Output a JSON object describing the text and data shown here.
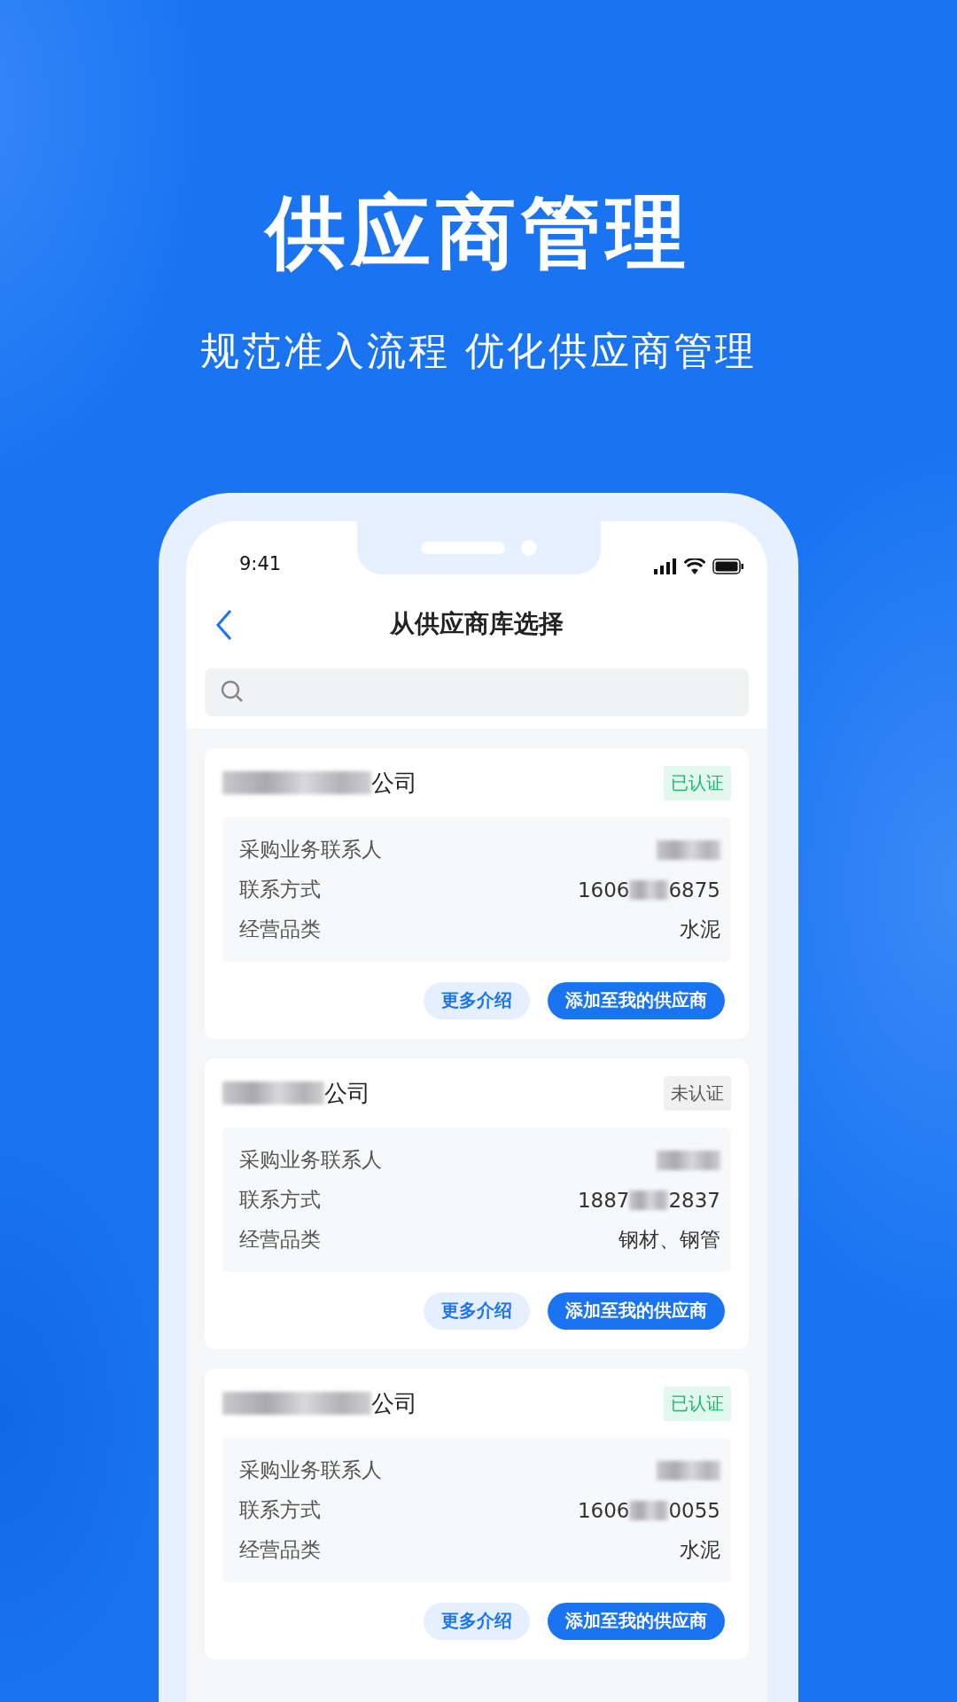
{
  "headline": "供应商管理",
  "subheadline": "规范准入流程 优化供应商管理",
  "status_bar": {
    "time": "9:41"
  },
  "nav": {
    "title": "从供应商库选择"
  },
  "suppliers": [
    {
      "name": [
        {
          "kind": "redacted"
        },
        {
          "kind": "text",
          "text": "公司"
        }
      ],
      "certified": true,
      "badge": "已认证",
      "fields": [
        {
          "label": "采购业务联系人",
          "value": [
            {
              "kind": "redacted"
            }
          ]
        },
        {
          "label": "联系方式",
          "value": [
            {
              "kind": "text",
              "text": "1606"
            },
            {
              "kind": "redacted"
            },
            {
              "kind": "text",
              "text": "6875"
            }
          ]
        },
        {
          "label": "经营品类",
          "value": [
            {
              "kind": "text",
              "text": "水泥"
            }
          ]
        }
      ],
      "buttons": [
        "更多介绍",
        "添加至我的供应商"
      ]
    },
    {
      "name": [
        {
          "kind": "redacted"
        },
        {
          "kind": "text",
          "text": "公司"
        }
      ],
      "certified": false,
      "badge": "未认证",
      "fields": [
        {
          "label": "采购业务联系人",
          "value": [
            {
              "kind": "redacted"
            }
          ]
        },
        {
          "label": "联系方式",
          "value": [
            {
              "kind": "text",
              "text": "1887"
            },
            {
              "kind": "redacted"
            },
            {
              "kind": "text",
              "text": "2837"
            }
          ]
        },
        {
          "label": "经营品类",
          "value": [
            {
              "kind": "text",
              "text": "钢材、钢管"
            }
          ]
        }
      ],
      "buttons": [
        "更多介绍",
        "添加至我的供应商"
      ]
    },
    {
      "name": [
        {
          "kind": "redacted"
        },
        {
          "kind": "text",
          "text": "公司"
        }
      ],
      "certified": true,
      "badge": "已认证",
      "fields": [
        {
          "label": "采购业务联系人",
          "value": [
            {
              "kind": "redacted"
            }
          ]
        },
        {
          "label": "联系方式",
          "value": [
            {
              "kind": "text",
              "text": "1606"
            },
            {
              "kind": "redacted"
            },
            {
              "kind": "text",
              "text": "0055"
            }
          ]
        },
        {
          "label": "经营品类",
          "value": [
            {
              "kind": "text",
              "text": "水泥"
            }
          ]
        }
      ],
      "buttons": [
        "更多介绍",
        "添加至我的供应商"
      ]
    }
  ]
}
